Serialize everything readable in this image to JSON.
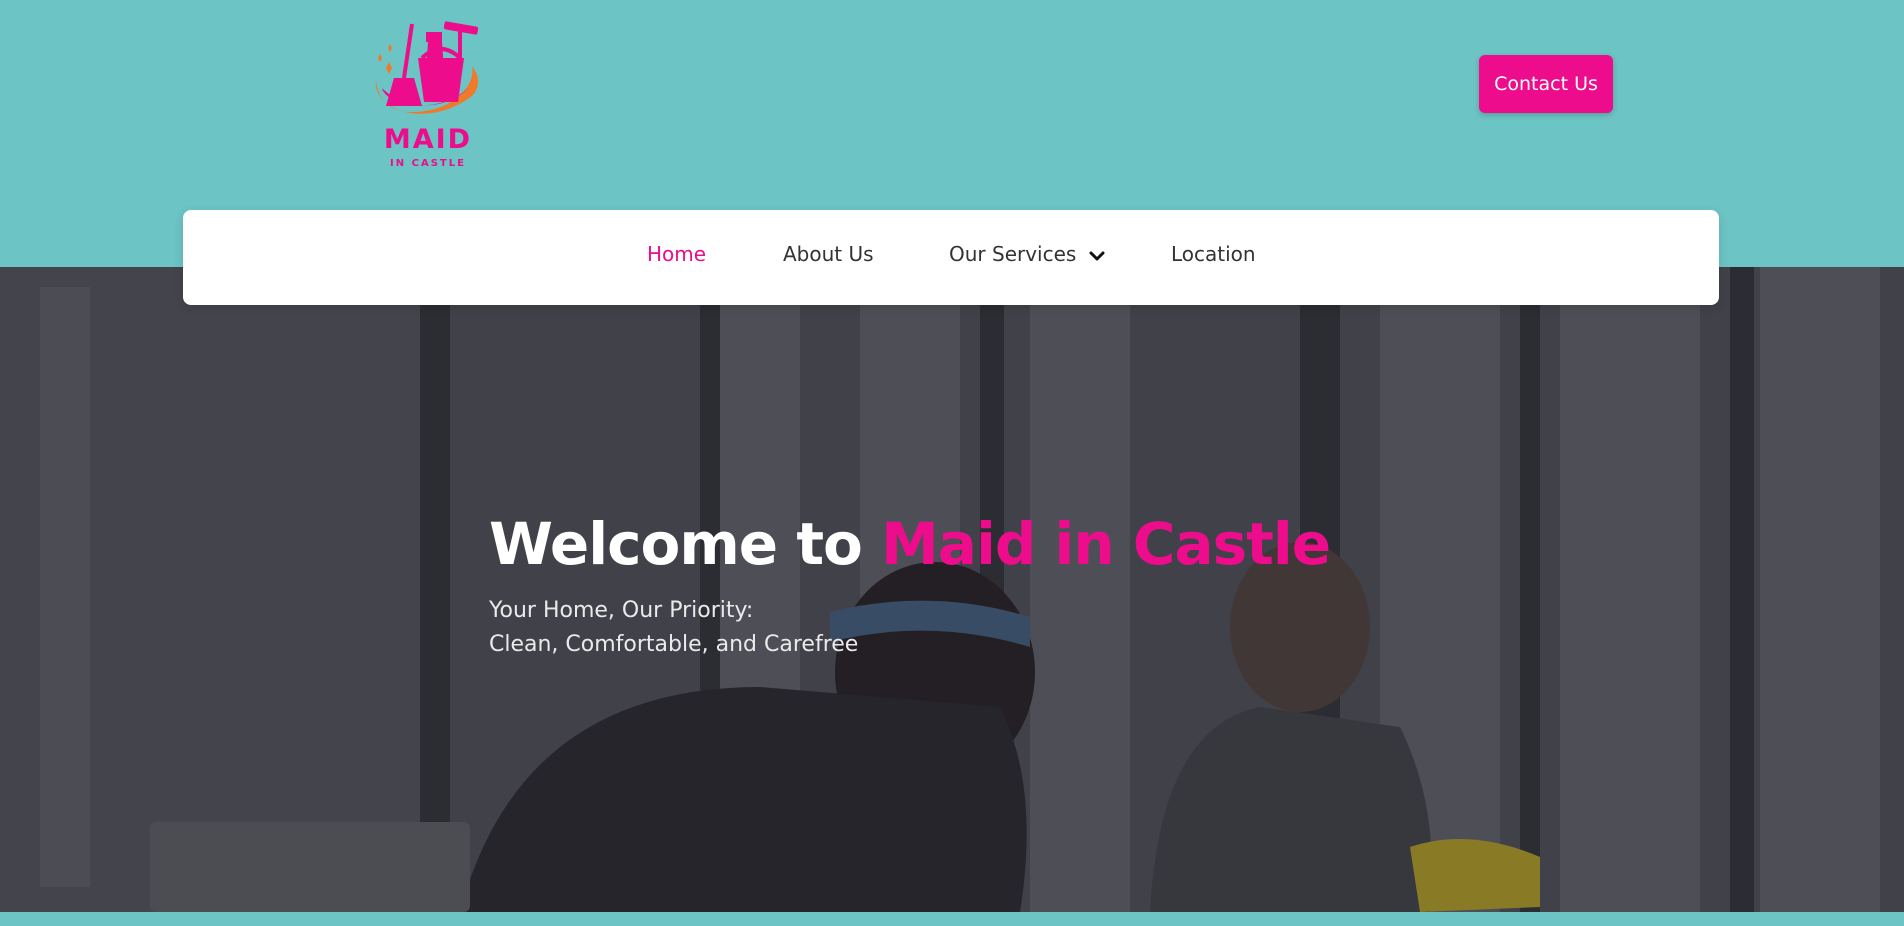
{
  "brand": {
    "logo_title": "MAID",
    "logo_subtitle": "IN CASTLE",
    "pink": "#ec0c8c",
    "teal": "#6cc4c4",
    "orange": "#f07a2a"
  },
  "header": {
    "contact_label": "Contact Us"
  },
  "nav": {
    "items": [
      {
        "label": "Home",
        "active": true
      },
      {
        "label": "About Us"
      },
      {
        "label": "Our Services",
        "icon": "chevron-down-icon"
      },
      {
        "label": "Location"
      }
    ]
  },
  "hero": {
    "title_prefix": "Welcome to ",
    "title_accent": "Maid in Castle",
    "subtitle_line1": "Your Home, Our Priority:",
    "subtitle_line2": "Clean, Comfortable, and Carefree"
  }
}
